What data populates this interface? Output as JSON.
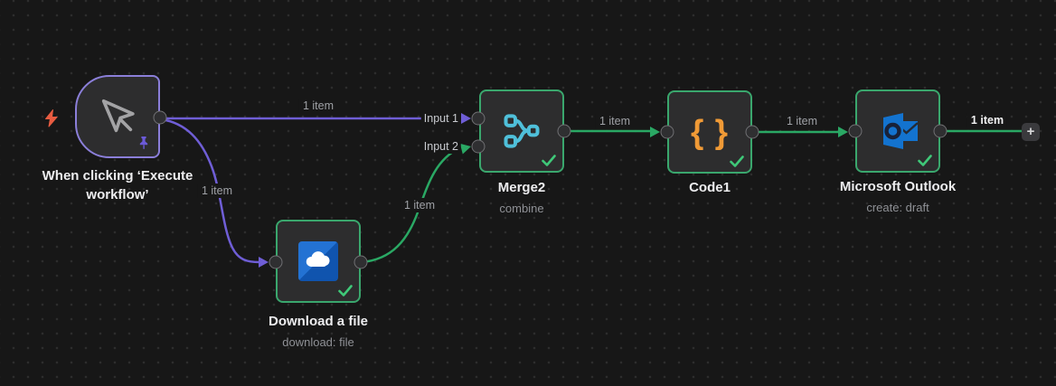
{
  "workflow": {
    "nodes": [
      {
        "name": "When clicking ‘Execute workflow’",
        "icon": "mouse-pointer",
        "type": "manual-trigger",
        "pinned": true
      },
      {
        "name": "Download a file",
        "subtitle": "download: file",
        "icon": "onedrive-cloud",
        "status": "success"
      },
      {
        "name": "Merge2",
        "subtitle": "combine",
        "icon": "merge-branches",
        "inputs": [
          "Input 1",
          "Input 2"
        ],
        "status": "success"
      },
      {
        "name": "Code1",
        "icon": "code-braces",
        "status": "success"
      },
      {
        "name": "Microsoft Outlook",
        "subtitle": "create: draft",
        "icon": "outlook",
        "status": "success"
      }
    ],
    "edges": [
      {
        "from": "When clicking ‘Execute workflow’",
        "to": "Merge2 / Input 1",
        "label": "1 item",
        "color": "purple"
      },
      {
        "from": "When clicking ‘Execute workflow’",
        "to": "Download a file",
        "label": "1 item",
        "color": "purple"
      },
      {
        "from": "Download a file",
        "to": "Merge2 / Input 2",
        "label": "1 item",
        "color": "green"
      },
      {
        "from": "Merge2",
        "to": "Code1",
        "label": "1 item",
        "color": "green"
      },
      {
        "from": "Code1",
        "to": "Microsoft Outlook",
        "label": "1 item",
        "color": "green"
      },
      {
        "from": "Microsoft Outlook",
        "to": "add-node-button",
        "label": "1 item",
        "color": "green",
        "highlighted": true
      }
    ],
    "add_button_label": "+",
    "code_icon_text": "{ }"
  },
  "colors": {
    "canvas_bg": "#171717",
    "canvas_dots": "#2d2d2d",
    "node_bg": "#2d2d2e",
    "node_border_success": "#3aa76d",
    "trigger_border": "#8b7fd9",
    "edge_green": "#2aa864",
    "edge_purple": "#6f5ed6",
    "check_green": "#3fc979",
    "merge_icon_cyan": "#4fc0da",
    "code_icon_orange": "#f09a36",
    "bolt_orange": "#e85c41",
    "pin_purple": "#6b5ad8",
    "onedrive_blue_light": "#2372d3",
    "onedrive_blue_dark": "#1054ae",
    "outlook_blue": "#1373cf"
  }
}
